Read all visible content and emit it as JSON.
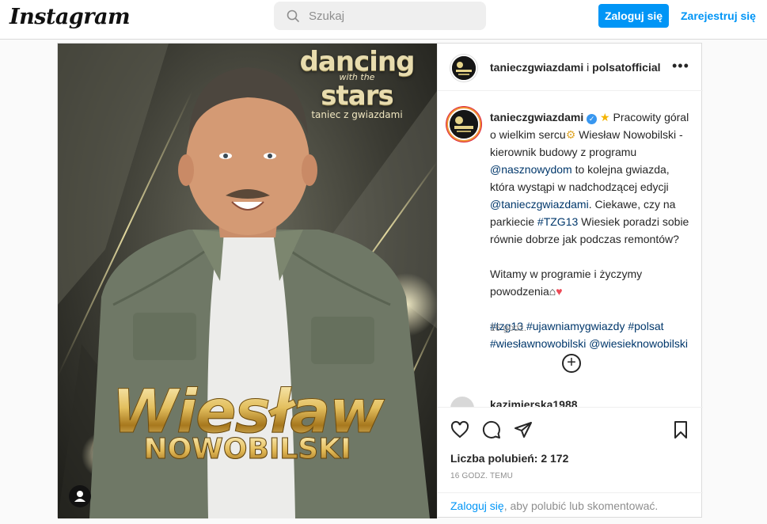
{
  "header": {
    "logo": "Instagram",
    "search_placeholder": "Szukaj",
    "login_button": "Zaloguj się",
    "register_link": "Zarejestruj się"
  },
  "media": {
    "brand_line1": "dancing",
    "brand_line2": "with the",
    "brand_line3": "stars",
    "brand_line4": "taniec z gwiazdami",
    "name_first": "Wiesław",
    "name_last": "NOWOBILSKI"
  },
  "post_header": {
    "author": "tanieczgwiazdami",
    "and": "i",
    "coauthor": "polsatofficial"
  },
  "caption": {
    "username": "tanieczgwiazdami",
    "text_1": "Pracowity góral o wielkim sercu",
    "text_2": "Wiesław Nowobilski - kierownik budowy z programu",
    "mention_1": "@nasznowydom",
    "text_3": "to kolejna gwiazda, która wystąpi w nadchodzącej edycji",
    "mention_2": "@tanieczgwiazdami",
    "text_4": ". Ciekawe, czy na parkiecie",
    "hashtag_1": "#TZG13",
    "text_5": "Wiesiek poradzi sobie równie dobrze jak podczas remontów?",
    "text_6": "Witamy w programie i życzymy powodzenia",
    "hashtag_2": "#tzg13",
    "hashtag_3": "#ujawniamygwiazdy",
    "hashtag_4": "#polsat",
    "hashtag_5": "#wiesławnowobilski",
    "mention_3": "@wiesieknowobilski",
    "time": "16 godz."
  },
  "comment": {
    "username": "kazimierska1988"
  },
  "actions": {
    "likes": "Liczba polubień: 2 172",
    "posted_ago": "16 GODZ. TEMU"
  },
  "footer": {
    "login_link": "Zaloguj się",
    "login_text": ", aby polubić lub skomentować."
  },
  "colors": {
    "primary_blue": "#0095f6",
    "link_blue": "#00376b",
    "heart_red": "#ed4956"
  }
}
